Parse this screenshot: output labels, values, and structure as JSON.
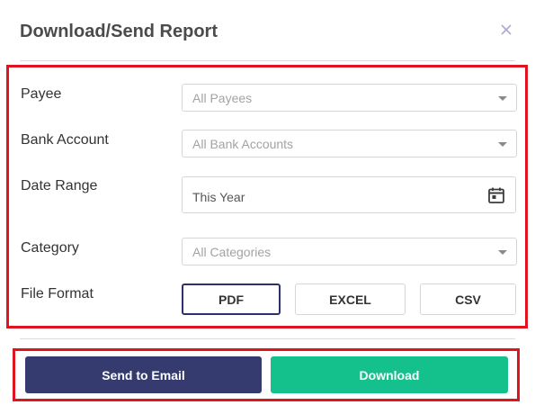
{
  "dialog": {
    "title": "Download/Send Report",
    "close_icon": "close-icon"
  },
  "form": {
    "payee": {
      "label": "Payee",
      "value": "All Payees"
    },
    "bank_account": {
      "label": "Bank Account",
      "value": "All Bank Accounts"
    },
    "date_range": {
      "label": "Date Range",
      "value": "This Year",
      "icon": "calendar-icon"
    },
    "category": {
      "label": "Category",
      "value": "All Categories"
    },
    "file_format": {
      "label": "File Format",
      "options": [
        "PDF",
        "EXCEL",
        "CSV"
      ],
      "selected": "PDF"
    }
  },
  "actions": {
    "send_email": "Send to Email",
    "download": "Download"
  },
  "colors": {
    "highlight_frame": "#e0141e",
    "send_button": "#353b6e",
    "download_button": "#14c08b",
    "selected_format_border": "#2d2f6e"
  }
}
